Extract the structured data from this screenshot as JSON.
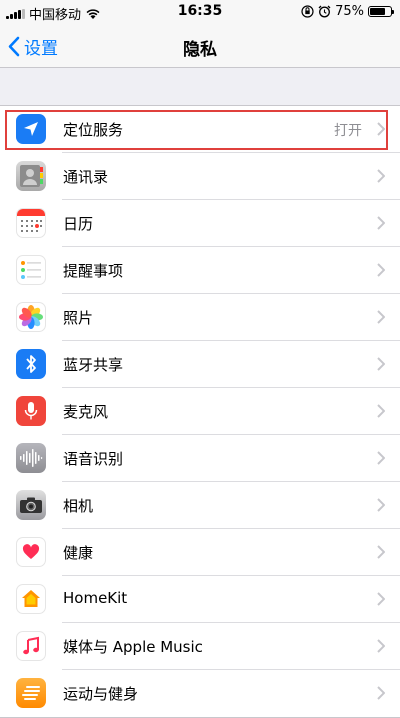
{
  "status_bar": {
    "carrier": "中国移动",
    "time": "16:35",
    "battery": "75%",
    "battery_level": 0.75
  },
  "nav": {
    "back_label": "设置",
    "title": "隐私"
  },
  "items": [
    {
      "label": "定位服务",
      "detail": "打开",
      "icon": "location-arrow-icon",
      "color": "#1a7cf5"
    },
    {
      "label": "通讯录",
      "detail": "",
      "icon": "contacts-icon",
      "color": "#b8b8b8"
    },
    {
      "label": "日历",
      "detail": "",
      "icon": "calendar-icon",
      "color": "#ffffff"
    },
    {
      "label": "提醒事项",
      "detail": "",
      "icon": "reminders-icon",
      "color": "#ffffff"
    },
    {
      "label": "照片",
      "detail": "",
      "icon": "photos-icon",
      "color": "#ffffff"
    },
    {
      "label": "蓝牙共享",
      "detail": "",
      "icon": "bluetooth-icon",
      "color": "#1a7cf5"
    },
    {
      "label": "麦克风",
      "detail": "",
      "icon": "microphone-icon",
      "color": "#f0453b"
    },
    {
      "label": "语音识别",
      "detail": "",
      "icon": "speech-waveform-icon",
      "color": "#9a9aa0"
    },
    {
      "label": "相机",
      "detail": "",
      "icon": "camera-icon",
      "color": "#8e8e93"
    },
    {
      "label": "健康",
      "detail": "",
      "icon": "health-heart-icon",
      "color": "#ffffff"
    },
    {
      "label": "HomeKit",
      "detail": "",
      "icon": "homekit-house-icon",
      "color": "#ffffff"
    },
    {
      "label": "媒体与 Apple Music",
      "detail": "",
      "icon": "music-note-icon",
      "color": "#ffffff"
    },
    {
      "label": "运动与健身",
      "detail": "",
      "icon": "motion-fitness-icon",
      "color": "#ff9500"
    }
  ]
}
